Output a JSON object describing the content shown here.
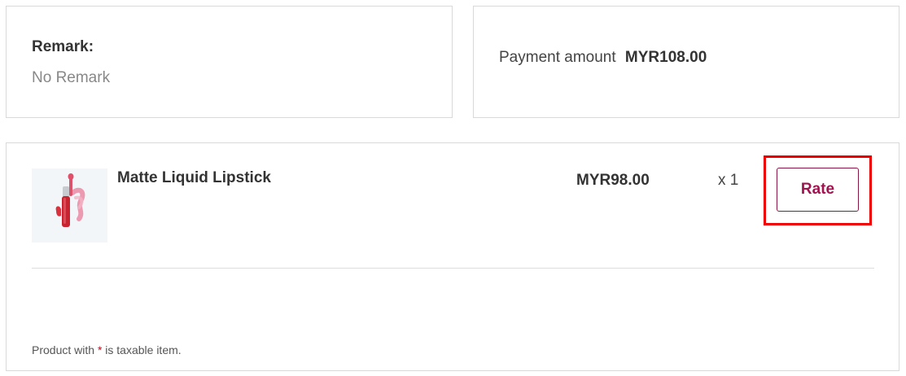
{
  "remark": {
    "title": "Remark:",
    "value": "No Remark"
  },
  "payment": {
    "label": "Payment amount",
    "amount": "MYR108.00"
  },
  "order_items": [
    {
      "name": "Matte Liquid Lipstick",
      "price": "MYR98.00",
      "quantity": "x 1",
      "rate_label": "Rate",
      "thumbnail_icon": "lipstick-image"
    }
  ],
  "footnote": {
    "prefix": "Product with",
    "asterisk": "*",
    "suffix": "is taxable item."
  },
  "colors": {
    "accent": "#a0134f",
    "highlight": "#ee0000",
    "border": "#d9d9d9"
  }
}
